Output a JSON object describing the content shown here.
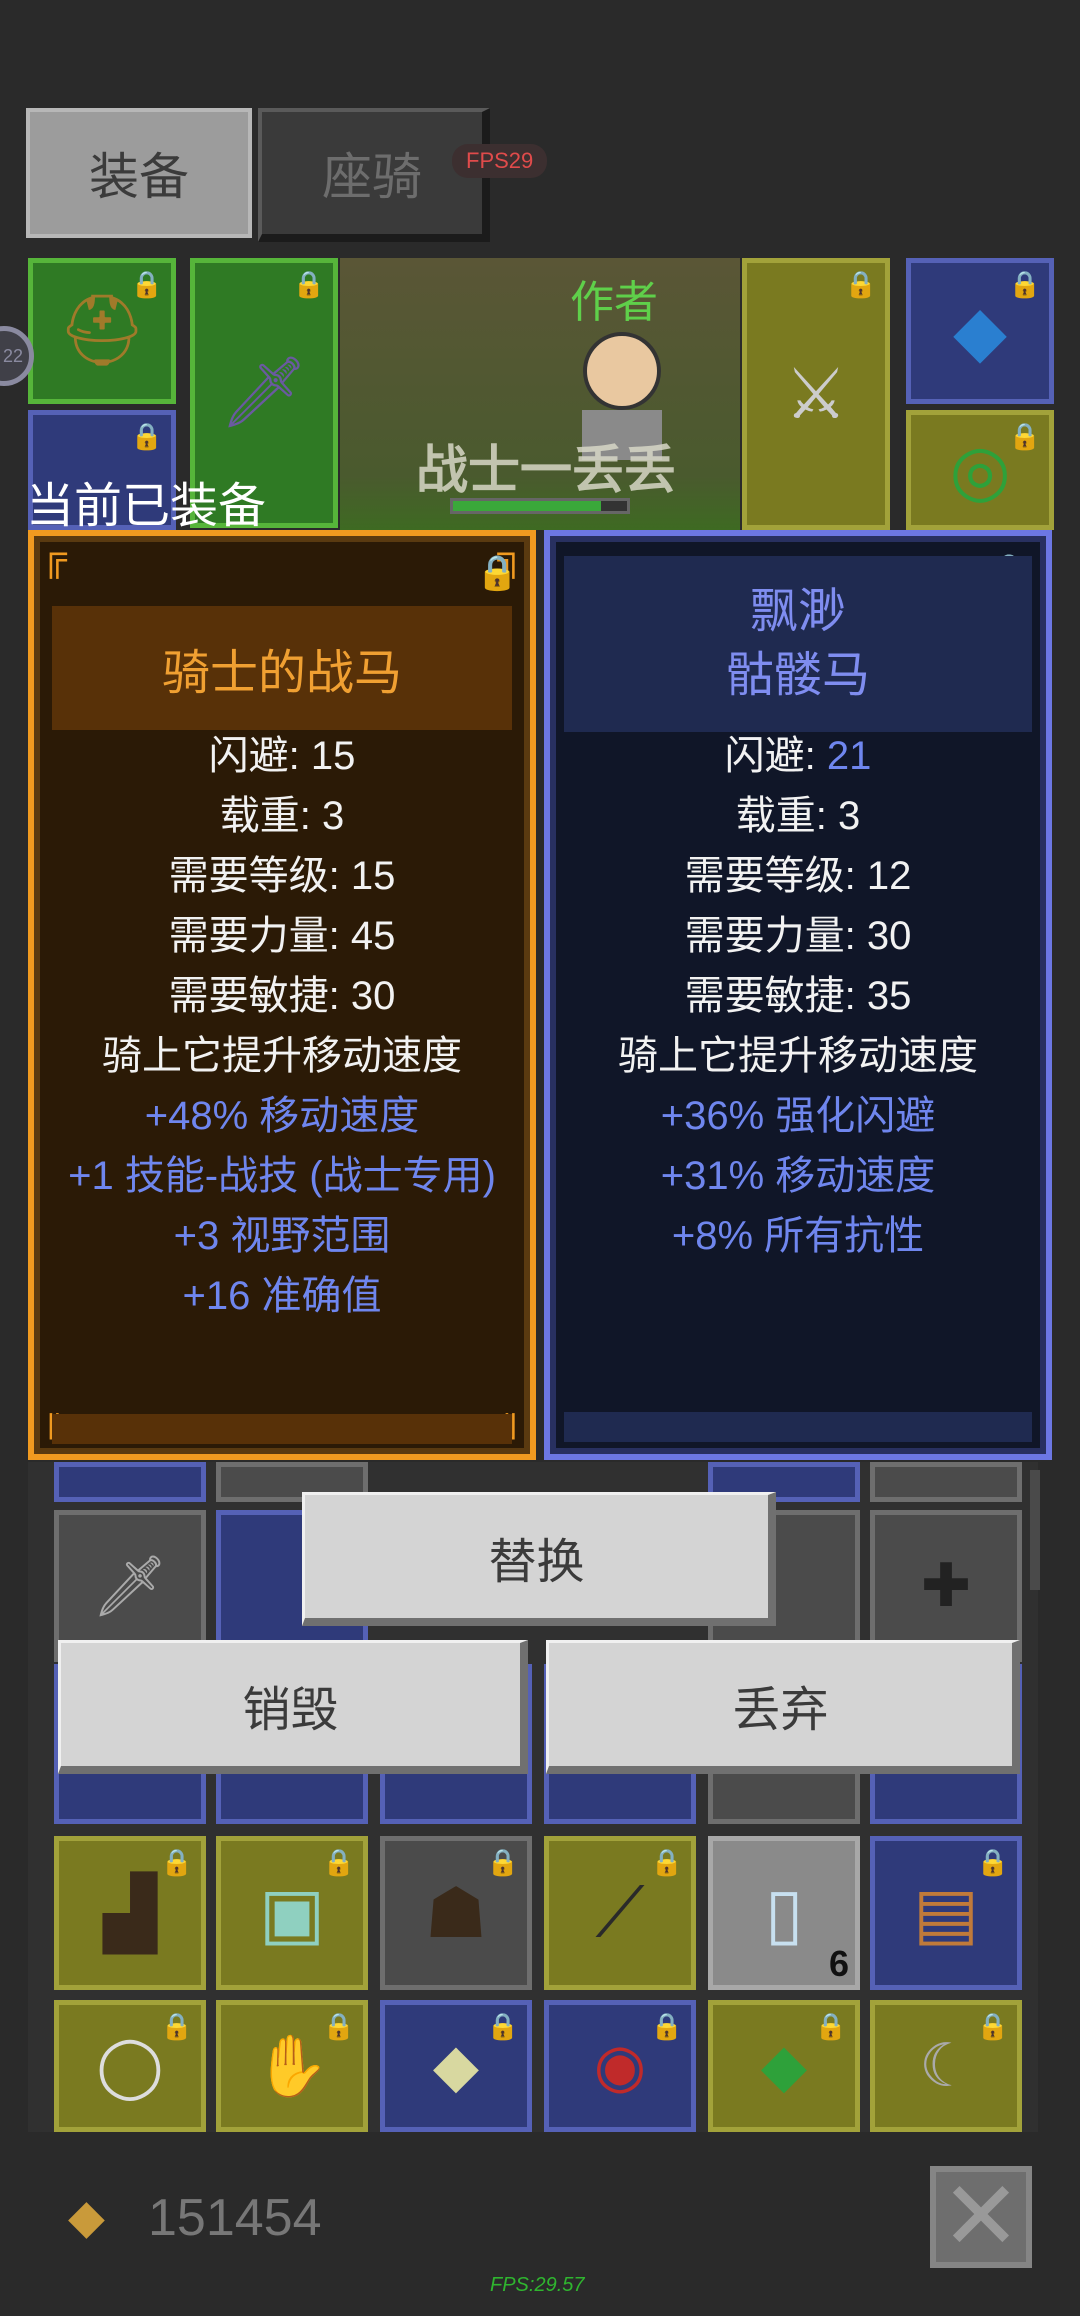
{
  "tabs": {
    "equip": "装备",
    "mount": "座骑"
  },
  "fps_badge": "FPS29",
  "side_badge": "22",
  "scene": {
    "author": "作者",
    "character_name": "战士一丢丢"
  },
  "current_equipped_label": "当前已装备",
  "current_item": {
    "name": "骑士的战马",
    "locked": true,
    "stats": [
      {
        "label": "闪避",
        "value": "15"
      },
      {
        "label": "载重",
        "value": "3"
      },
      {
        "label": "需要等级",
        "value": "15"
      },
      {
        "label": "需要力量",
        "value": "45"
      },
      {
        "label": "需要敏捷",
        "value": "30"
      }
    ],
    "description": "骑上它提升移动速度",
    "bonuses": [
      "+48% 移动速度",
      "+1 技能-战技 (战士专用)",
      "+3 视野范围",
      "+16 准确值"
    ],
    "rarity_color": "#f09a20"
  },
  "compare_item": {
    "name_line1": "飘渺",
    "name_line2": "骷髅马",
    "locked": false,
    "stats": [
      {
        "label": "闪避",
        "value": "21"
      },
      {
        "label": "载重",
        "value": "3"
      },
      {
        "label": "需要等级",
        "value": "12"
      },
      {
        "label": "需要力量",
        "value": "30"
      },
      {
        "label": "需要敏捷",
        "value": "35"
      }
    ],
    "description": "骑上它提升移动速度",
    "bonuses": [
      "+36% 强化闪避",
      "+31% 移动速度",
      "+8% 所有抗性"
    ],
    "rarity_color": "#6c77e3"
  },
  "actions": {
    "replace": "替换",
    "destroy": "销毁",
    "discard": "丢弃"
  },
  "inventory": {
    "stack_count": "6"
  },
  "gold": "151454",
  "fps_bottom": "FPS:29.57"
}
